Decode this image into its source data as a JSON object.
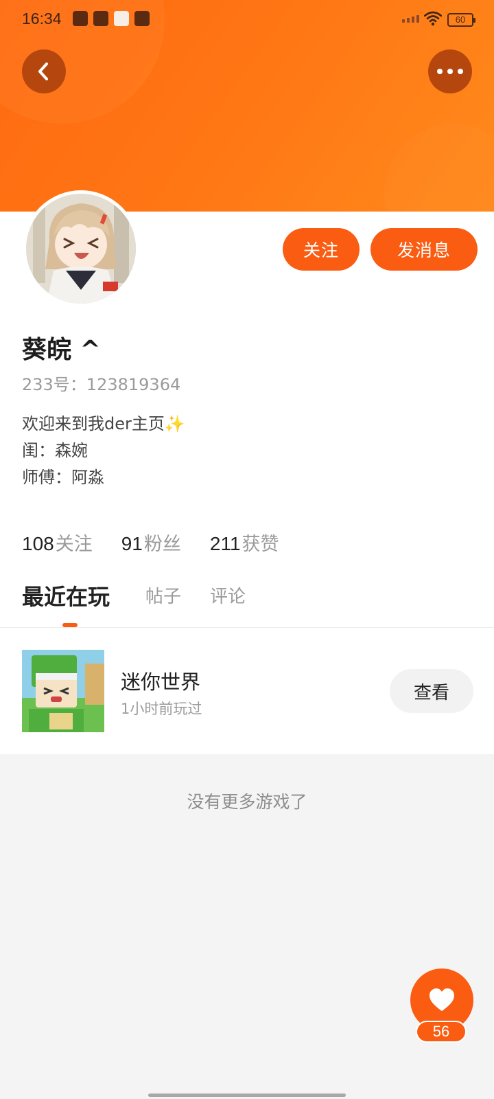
{
  "status_bar": {
    "time": "16:34",
    "battery": "60"
  },
  "header": {
    "back_icon": "chevron-left-icon",
    "more_icon": "more-dots-icon",
    "accent_color": "#fa5c12"
  },
  "profile": {
    "name": "葵皖 ^",
    "uid": "233号：123819364",
    "bio": [
      "欢迎来到我der主页",
      "闺：森婉",
      "师傅：阿淼"
    ],
    "bio_emoji": "✨",
    "follow_label": "关注",
    "message_label": "发消息"
  },
  "stats": [
    {
      "num": "108",
      "label": "关注"
    },
    {
      "num": "91",
      "label": "粉丝"
    },
    {
      "num": "211",
      "label": "获赞"
    }
  ],
  "tabs": [
    {
      "label": "最近在玩",
      "active": true
    },
    {
      "label": "帖子",
      "active": false
    },
    {
      "label": "评论",
      "active": false
    }
  ],
  "games": [
    {
      "name": "迷你世界",
      "time": "1小时前玩过",
      "action": "查看"
    }
  ],
  "empty_text": "没有更多游戏了",
  "like": {
    "icon": "heart-icon",
    "count": "56"
  }
}
